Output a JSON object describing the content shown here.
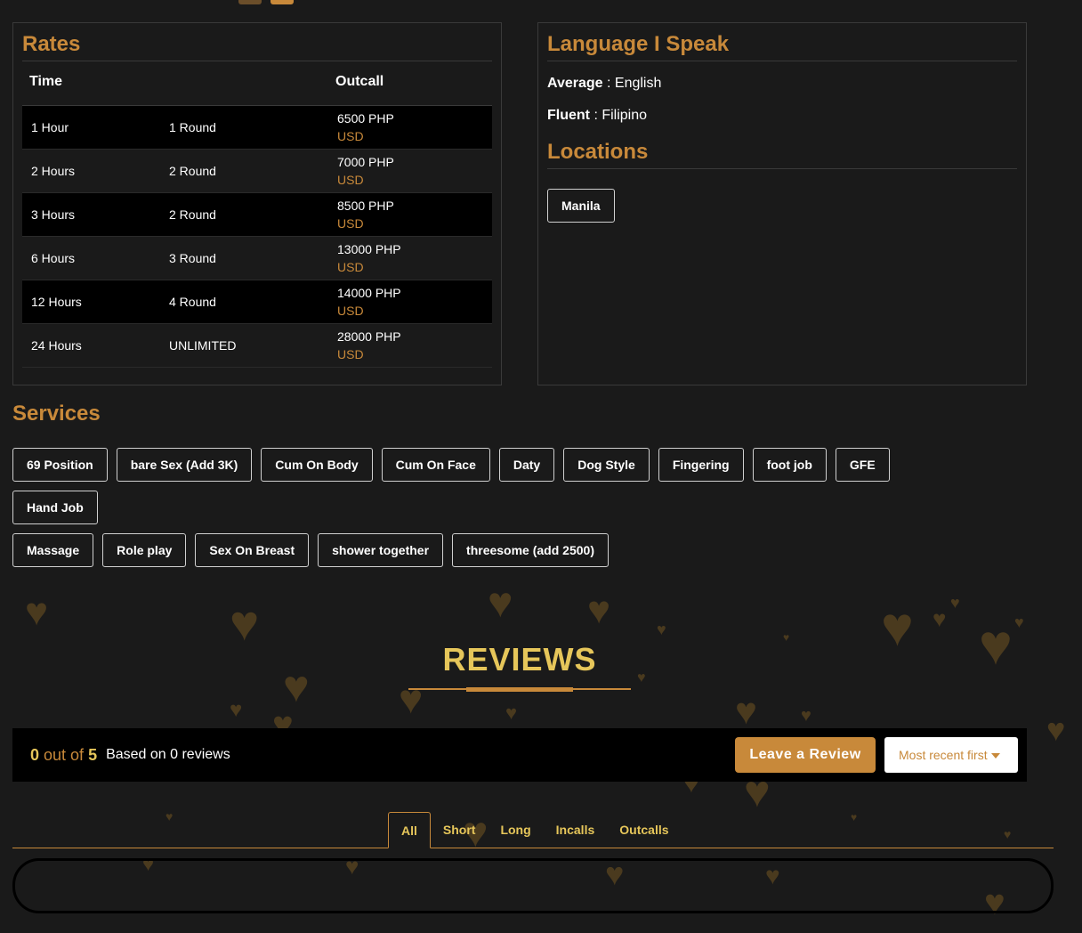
{
  "rates": {
    "title": "Rates",
    "headers": {
      "time": "Time",
      "outcall": "Outcall"
    },
    "rows": [
      {
        "time": "1 Hour",
        "rounds": "1 Round",
        "price": "6500 PHP",
        "usd": "USD"
      },
      {
        "time": "2 Hours",
        "rounds": "2 Round",
        "price": "7000 PHP",
        "usd": "USD"
      },
      {
        "time": "3 Hours",
        "rounds": "2 Round",
        "price": "8500 PHP",
        "usd": "USD"
      },
      {
        "time": "6 Hours",
        "rounds": "3 Round",
        "price": "13000 PHP",
        "usd": "USD"
      },
      {
        "time": "12 Hours",
        "rounds": "4 Round",
        "price": "14000 PHP",
        "usd": "USD"
      },
      {
        "time": "24 Hours",
        "rounds": "UNLIMITED",
        "price": "28000 PHP",
        "usd": "USD"
      }
    ]
  },
  "languages": {
    "title": "Language I Speak",
    "items": [
      {
        "level": "Average",
        "sep": " : ",
        "language": "English"
      },
      {
        "level": "Fluent",
        "sep": " : ",
        "language": "Filipino"
      }
    ]
  },
  "locations": {
    "title": "Locations",
    "items": [
      "Manila"
    ]
  },
  "services": {
    "title": "Services",
    "items": [
      "69 Position",
      "bare Sex (Add 3K)",
      "Cum On Body",
      "Cum On Face",
      "Daty",
      "Dog Style",
      "Fingering",
      "foot job",
      "GFE",
      "Hand Job",
      "Massage",
      "Role play",
      "Sex On Breast",
      "shower together",
      "threesome (add 2500)"
    ]
  },
  "reviews": {
    "title": "REVIEWS",
    "score": "0",
    "out_of": " out of ",
    "max": "5",
    "based_on": "Based on 0 reviews",
    "leave_label": "Leave a Review",
    "sort_label": "Most recent first",
    "tabs": [
      "All",
      "Short",
      "Long",
      "Incalls",
      "Outcalls"
    ],
    "active_tab": "All"
  },
  "colors": {
    "accent": "#c8893a",
    "highlight": "#e6c65a",
    "background": "#1a1a1a"
  },
  "icons": {
    "decor": "heart-icon",
    "dropdown": "caret-down-icon"
  }
}
